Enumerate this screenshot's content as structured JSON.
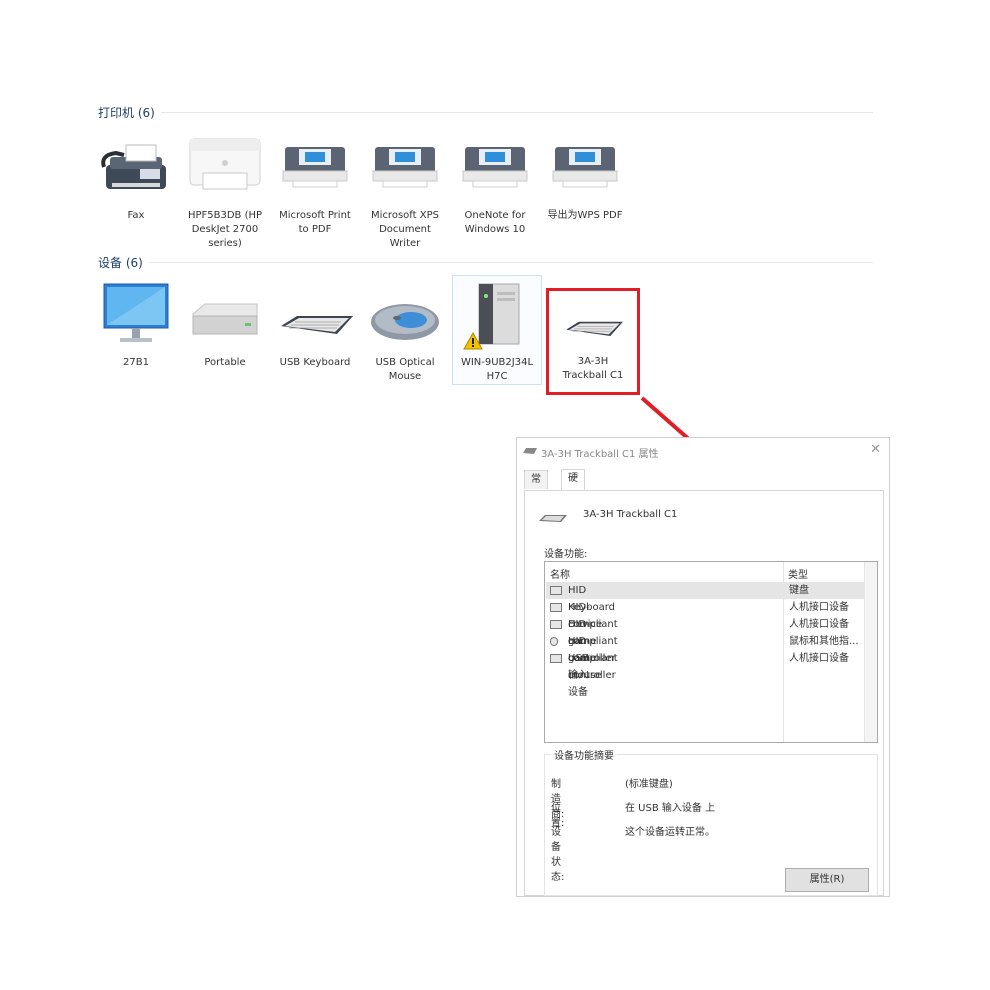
{
  "printers": {
    "header": "打印机 (6)",
    "items": [
      {
        "label": "Fax",
        "icon": "fax-icon"
      },
      {
        "label": "HPF5B3DB (HP\nDeskJet 2700\nseries)",
        "icon": "inkjet-printer-icon"
      },
      {
        "label": "Microsoft Print\nto PDF",
        "icon": "printer-icon"
      },
      {
        "label": "Microsoft XPS\nDocument\nWriter",
        "icon": "printer-icon"
      },
      {
        "label": "OneNote for\nWindows 10",
        "icon": "printer-icon"
      },
      {
        "label": "导出为WPS PDF",
        "icon": "printer-icon"
      }
    ]
  },
  "devices": {
    "header": "设备 (6)",
    "items": [
      {
        "label": "27B1",
        "icon": "monitor-icon"
      },
      {
        "label": "Portable",
        "icon": "drive-icon"
      },
      {
        "label": "USB Keyboard",
        "icon": "keyboard-icon"
      },
      {
        "label": "USB Optical\nMouse",
        "icon": "mouse-icon"
      },
      {
        "label": "WIN-9UB2J34L\nH7C",
        "icon": "computer-tower-icon"
      },
      {
        "label": "3A-3H\nTrackball C1",
        "icon": "keyboard-icon"
      }
    ]
  },
  "dialog": {
    "title": "3A-3H Trackball C1 属性",
    "close_glyph": "✕",
    "tabs": [
      "常规",
      "硬件"
    ],
    "active_tab": "硬件",
    "device_name": "3A-3H Trackball C1",
    "functions_label": "设备功能:",
    "columns": [
      "名称",
      "类型"
    ],
    "rows": [
      {
        "name": "HID Keyboard Device",
        "type": "键盘",
        "icon": "keyboard-small-icon",
        "selected": true
      },
      {
        "name": "HID-compliant game controller",
        "type": "人机接口设备",
        "icon": "hid-device-icon"
      },
      {
        "name": "HID-compliant game controller",
        "type": "人机接口设备",
        "icon": "hid-device-icon"
      },
      {
        "name": "HID-compliant mouse",
        "type": "鼠标和其他指...",
        "icon": "mouse-small-icon"
      },
      {
        "name": "USB 输入设备",
        "type": "人机接口设备",
        "icon": "hid-device-icon"
      }
    ],
    "summary": {
      "legend": "设备功能摘要",
      "manufacturer_label": "制造商:",
      "manufacturer": "(标准键盘)",
      "location_label": "位置:",
      "location": "在 USB 输入设备 上",
      "status_label": "设备状态:",
      "status": "这个设备运转正常。"
    },
    "properties_button": "属性(R)"
  },
  "highlight_color": "#e01e26"
}
